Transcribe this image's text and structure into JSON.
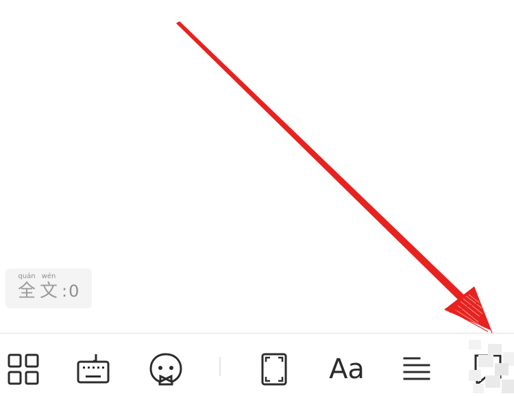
{
  "word_count": {
    "char1": {
      "pinyin": "quán",
      "hanzi": "全"
    },
    "char2": {
      "pinyin": "wén",
      "hanzi": "文"
    },
    "value_text": ":0"
  },
  "toolbar": {
    "buttons": [
      {
        "name": "apps-icon"
      },
      {
        "name": "keyboard-icon"
      },
      {
        "name": "emoji-icon"
      },
      {
        "name": "fullscreen-icon"
      },
      {
        "name": "font-size-icon",
        "label": "Aa"
      },
      {
        "name": "align-left-icon"
      },
      {
        "name": "comment-icon"
      }
    ]
  },
  "annotation": {
    "arrow_color": "#e8221f",
    "icon_color": "#2b2b2b",
    "badge_bg": "#f4f4f4"
  }
}
